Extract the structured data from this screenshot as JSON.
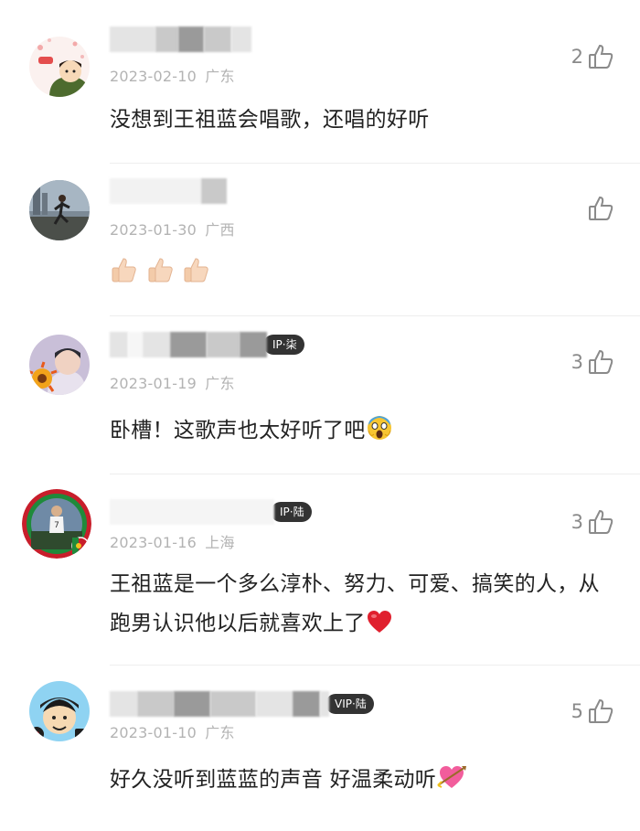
{
  "comments": [
    {
      "date": "2023-02-10",
      "location": "广东",
      "text": "没想到王祖蓝会唱歌，还唱的好听",
      "likes": "2",
      "avatar": "illustrated-girl-avatar"
    },
    {
      "date": "2023-01-30",
      "location": "广西",
      "text": "",
      "emoji": [
        "thumbs-up",
        "thumbs-up",
        "thumbs-up"
      ],
      "likes": "",
      "avatar": "skateboarder-photo-avatar"
    },
    {
      "date": "2023-01-19",
      "location": "广东",
      "text": "卧槽！这歌声也太好听了吧",
      "emoji": [
        "screaming-face"
      ],
      "likes": "3",
      "vip": "IP·柒",
      "avatar": "sunflower-portrait-avatar"
    },
    {
      "date": "2023-01-16",
      "location": "上海",
      "text": "王祖蓝是一个多么淳朴、努力、可爱、搞笑的人，从跑男认识他以后就喜欢上了",
      "emoji": [
        "red-heart"
      ],
      "likes": "3",
      "vip": "IP·陆",
      "avatar": "footballer-photo-avatar"
    },
    {
      "date": "2023-01-10",
      "location": "广东",
      "text": "好久没听到蓝蓝的声音 好温柔动听",
      "emoji": [
        "heart-with-arrow"
      ],
      "likes": "5",
      "vip": "VIP·陆",
      "avatar": "cartoon-boy-avatar"
    }
  ],
  "colors": {
    "text": "#222222",
    "meta": "#b3b3b3",
    "icon": "#8a8a8a",
    "vip_badge": "#333333"
  }
}
